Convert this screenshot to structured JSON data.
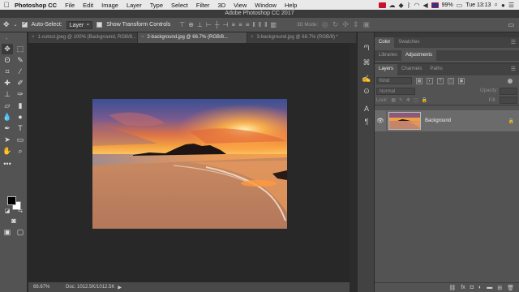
{
  "menubar": {
    "apple_icon": "apple-logo-icon",
    "items": [
      "Photoshop CC",
      "File",
      "Edit",
      "Image",
      "Layer",
      "Type",
      "Select",
      "Filter",
      "3D",
      "View",
      "Window",
      "Help"
    ],
    "battery": "99%",
    "time": "Tue 13:13"
  },
  "window_title": "Adobe Photoshop CC 2017",
  "options_bar": {
    "auto_select_label": "Auto-Select:",
    "auto_select_checked": true,
    "auto_select_target": "Layer",
    "transform_label": "Show Transform Controls",
    "transform_checked": false,
    "mode_3d_label": "3D Mode:"
  },
  "tabs": [
    {
      "label": "1-cutout.jpeg @ 100% (Background, RGB/8...",
      "active": false
    },
    {
      "label": "2-background.jpg @ 66.7% (RGB/8...",
      "active": true
    },
    {
      "label": "3-background.jpg @ 66.7% (RGB/8) *",
      "active": false
    }
  ],
  "status_bar": {
    "zoom": "66.67%",
    "doc_info": "Doc: 1012.5K/1012.5K"
  },
  "panels": {
    "top_tabs": [
      "Color",
      "Swatches"
    ],
    "top_active": "Color",
    "mid_tabs": [
      "Libraries",
      "Adjustments"
    ],
    "mid_active": "Adjustments",
    "layer_tabs": [
      "Layers",
      "Channels",
      "Paths"
    ],
    "layer_active": "Layers",
    "filter_kind": "Kind",
    "blend_mode": "Normal",
    "opacity_label": "Opacity:",
    "lock_label": "Lock:",
    "fill_label": "Fill:",
    "layers": [
      {
        "name": "Background",
        "visible": true,
        "locked": true
      }
    ]
  },
  "colors": {
    "foreground": "#000000",
    "background": "#ffffff",
    "panel": "#535353",
    "workspace": "#282828"
  }
}
